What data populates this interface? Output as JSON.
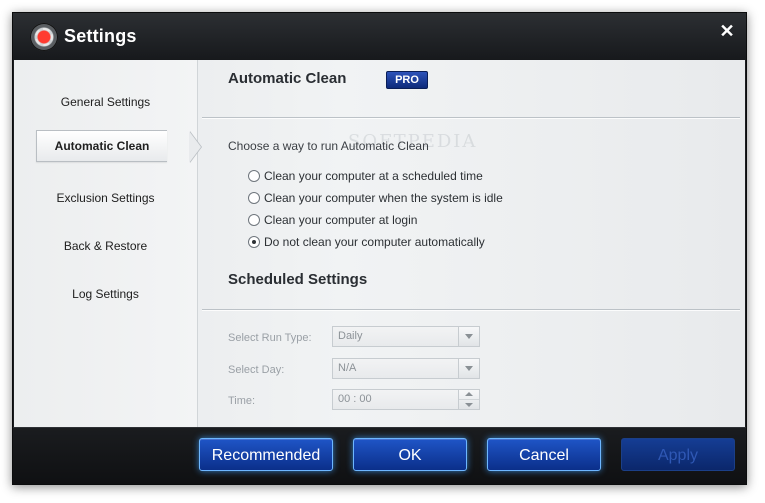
{
  "window": {
    "title": "Settings",
    "close_glyph": "✕",
    "app_icon": "gear-lifebuoy-icon"
  },
  "sidebar": {
    "items": [
      {
        "label": "General Settings",
        "active": false
      },
      {
        "label": "Automatic Clean",
        "active": true
      },
      {
        "label": "Exclusion Settings",
        "active": false
      },
      {
        "label": "Back & Restore",
        "active": false
      },
      {
        "label": "Log Settings",
        "active": false
      }
    ]
  },
  "automatic_clean": {
    "title": "Automatic Clean",
    "badge": "PRO",
    "prompt": "Choose a way to run Automatic Clean",
    "watermark": "SOFTPEDIA",
    "options": [
      {
        "label": "Clean your computer at a scheduled time",
        "selected": false
      },
      {
        "label": "Clean your computer when the system is idle",
        "selected": false
      },
      {
        "label": "Clean your computer at login",
        "selected": false
      },
      {
        "label": "Do not clean your computer automatically",
        "selected": true
      }
    ]
  },
  "scheduled_settings": {
    "title": "Scheduled Settings",
    "run_type_label": "Select Run Type:",
    "run_type_value": "Daily",
    "day_label": "Select Day:",
    "day_value": "N/A",
    "time_label": "Time:",
    "time_value": "00 : 00"
  },
  "footer": {
    "recommended_label": "Recommended",
    "ok_label": "OK",
    "cancel_label": "Cancel",
    "apply_label": "Apply",
    "apply_disabled": true
  },
  "colors": {
    "button_blue": "#1f55c7",
    "button_glow": "#6db6ff",
    "pro_badge": "#0d2a7a",
    "titlebar": "#1b1d20"
  }
}
